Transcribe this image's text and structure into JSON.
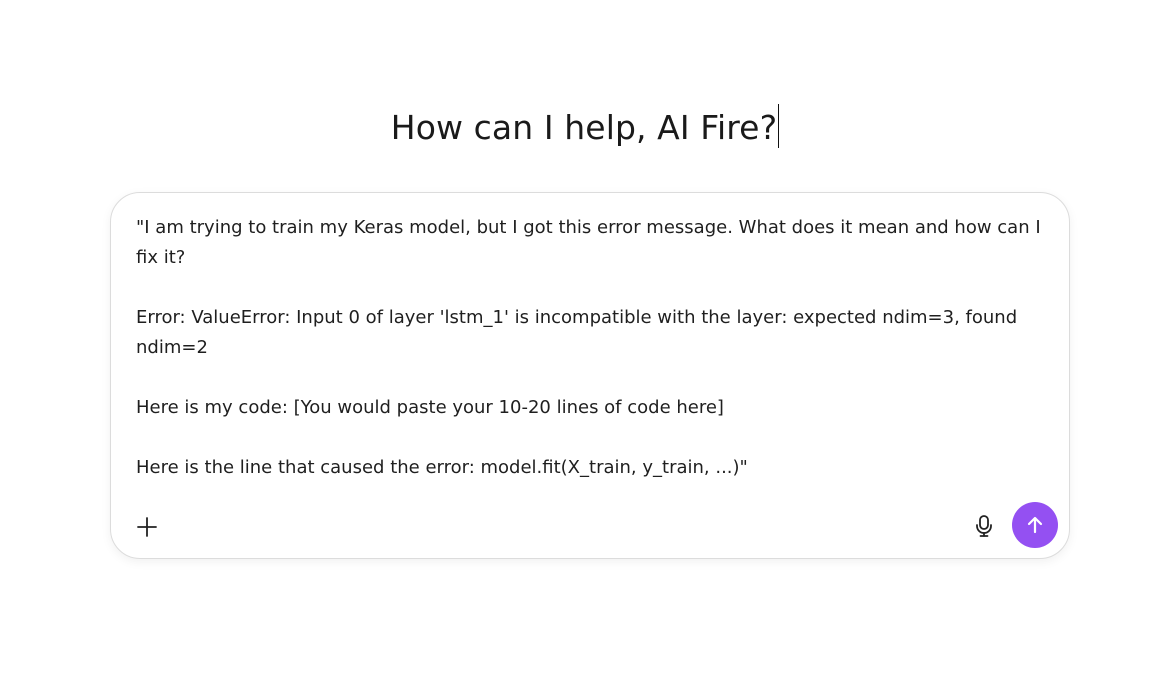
{
  "header": {
    "greeting": "How can I help, AI Fire?"
  },
  "composer": {
    "prompt_text": "\"I am trying to train my Keras model, but I got this error message. What does it mean and how can I fix it?\n\nError: ValueError: Input 0 of layer 'lstm_1' is incompatible with the layer: expected ndim=3, found ndim=2\n\nHere is my code: [You would paste your 10-20 lines of code here]\n\nHere is the line that caused the error: model.fit(X_train, y_train, ...)\"",
    "add_icon": "plus-icon",
    "mic_icon": "microphone-icon",
    "send_icon": "arrow-up-icon",
    "send_color": "#9450f2"
  }
}
